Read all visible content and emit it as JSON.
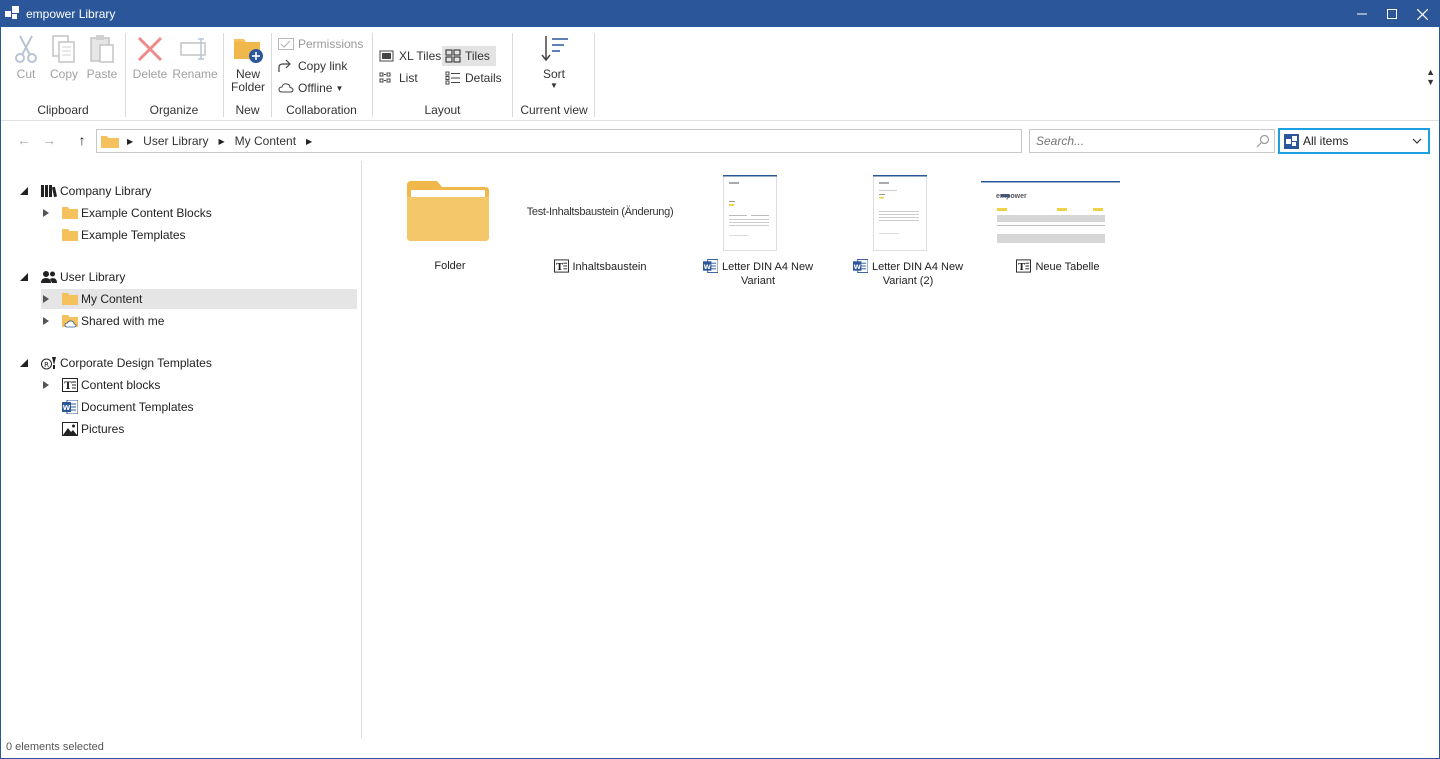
{
  "window": {
    "title": "empower Library"
  },
  "ribbon": {
    "clipboard": {
      "label": "Clipboard",
      "cut": "Cut",
      "copy": "Copy",
      "paste": "Paste"
    },
    "organize": {
      "label": "Organize",
      "delete": "Delete",
      "rename": "Rename"
    },
    "new": {
      "label": "New",
      "new_folder_line1": "New",
      "new_folder_line2": "Folder"
    },
    "collaboration": {
      "label": "Collaboration",
      "permissions": "Permissions",
      "copy_link": "Copy link",
      "offline": "Offline"
    },
    "layout": {
      "label": "Layout",
      "xl_tiles": "XL Tiles",
      "tiles": "Tiles",
      "list": "List",
      "details": "Details"
    },
    "current_view": {
      "label": "Current view",
      "sort": "Sort"
    }
  },
  "navbar": {
    "breadcrumb": [
      "User Library",
      "My Content"
    ],
    "search_placeholder": "Search...",
    "filter_value": "All items"
  },
  "tree": {
    "company_library": {
      "label": "Company Library",
      "children": [
        "Example Content Blocks",
        "Example Templates"
      ]
    },
    "user_library": {
      "label": "User Library",
      "children": [
        "My Content",
        "Shared with me"
      ]
    },
    "corporate_design": {
      "label": "Corporate Design Templates",
      "children": [
        "Content blocks",
        "Document Templates",
        "Pictures"
      ]
    }
  },
  "content": {
    "tiles": [
      {
        "name": "Folder",
        "type": "folder"
      },
      {
        "name": "Inhaltsbaustein",
        "type": "content-block",
        "preview_text": "Test-Inhaltsbaustein (Änderung)"
      },
      {
        "name_line1": "Letter DIN A4 New",
        "name_line2": "Variant",
        "type": "word"
      },
      {
        "name_line1": "Letter DIN A4 New",
        "name_line2": "Variant (2)",
        "type": "word"
      },
      {
        "name": "Neue Tabelle",
        "type": "content-block"
      }
    ],
    "preview_logo_text": "empower"
  },
  "statusbar": {
    "text": "0 elements selected"
  },
  "colors": {
    "titlebar": "#2b579a",
    "accent": "#1ba1e2",
    "folder": "#f5c15d",
    "word_blue": "#2b579a"
  }
}
